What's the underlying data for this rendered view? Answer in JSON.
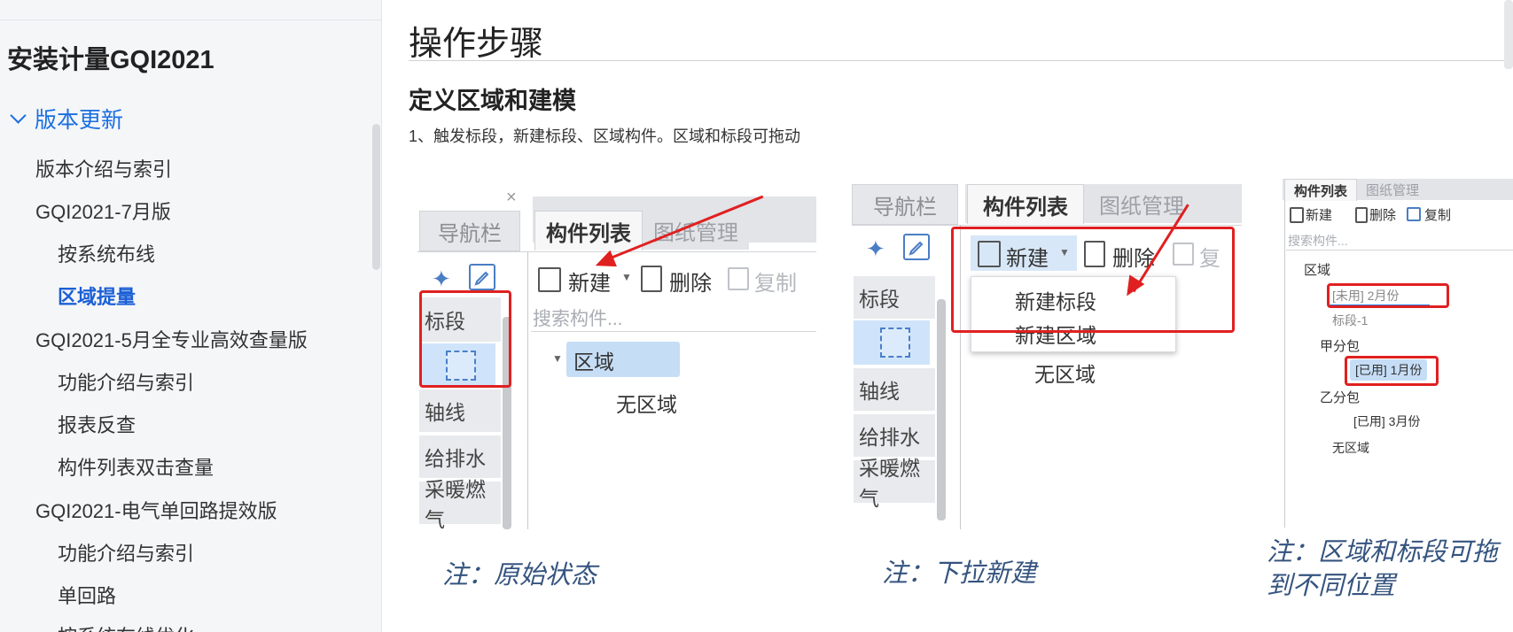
{
  "sidebar": {
    "title": "安装计量GQI2021",
    "section": "版本更新",
    "items": [
      {
        "label": "版本介绍与索引",
        "level": 1
      },
      {
        "label": "GQI2021-7月版",
        "level": 1
      },
      {
        "label": "按系统布线",
        "level": 2
      },
      {
        "label": "区域提量",
        "level": 2,
        "active": true
      },
      {
        "label": "GQI2021-5月全专业高效查量版",
        "level": 1
      },
      {
        "label": "功能介绍与索引",
        "level": 2
      },
      {
        "label": "报表反查",
        "level": 2
      },
      {
        "label": "构件列表双击查量",
        "level": 2
      },
      {
        "label": "GQI2021-电气单回路提效版",
        "level": 1
      },
      {
        "label": "功能介绍与索引",
        "level": 2
      },
      {
        "label": "单回路",
        "level": 2
      },
      {
        "label": "按系统布线优化",
        "level": 2
      }
    ]
  },
  "main": {
    "page_title": "操作步骤",
    "section_title": "定义区域和建模",
    "step_text": "1、触发标段，新建标段、区域构件。区域和标段可拖动"
  },
  "figure": {
    "panel1": {
      "nav_title": "导航栏",
      "close": "×",
      "tabs": [
        "构件列表",
        "图纸管理"
      ],
      "toolbar": {
        "new": "新建",
        "delete": "删除",
        "copy": "复制"
      },
      "search_placeholder": "搜索构件...",
      "nav_items": [
        "标段",
        "轴线",
        "给排水",
        "采暖燃气"
      ],
      "tree": {
        "root": "区域",
        "child": "无区域"
      },
      "caption": "注：原始状态"
    },
    "panel2": {
      "nav_title": "导航栏",
      "tabs": [
        "构件列表",
        "图纸管理"
      ],
      "toolbar": {
        "new": "新建",
        "delete": "删除",
        "copy": "复"
      },
      "menu": [
        "新建标段",
        "新建区域"
      ],
      "nav_items": [
        "标段",
        "轴线",
        "给排水",
        "采暖燃气"
      ],
      "tree_child": "无区域",
      "caption": "注：下拉新建"
    },
    "panel3": {
      "tabs": [
        "构件列表",
        "图纸管理"
      ],
      "toolbar": {
        "new": "新建",
        "delete": "删除",
        "copy": "复制"
      },
      "search_placeholder": "搜索构件...",
      "tree": {
        "root": "区域",
        "unused": "[未用] 2月份",
        "seg1": "标段-1",
        "pkg_a": "甲分包",
        "used1": "[已用] 1月份",
        "pkg_b": "乙分包",
        "used3": "[已用] 3月份",
        "none": "无区域"
      },
      "caption_line1": "注：区域和标段可拖",
      "caption_line2": "到不同位置"
    }
  },
  "colors": {
    "accent": "#1a6fe0",
    "annotation_red": "#e02020",
    "caption_blue": "#35547f"
  }
}
